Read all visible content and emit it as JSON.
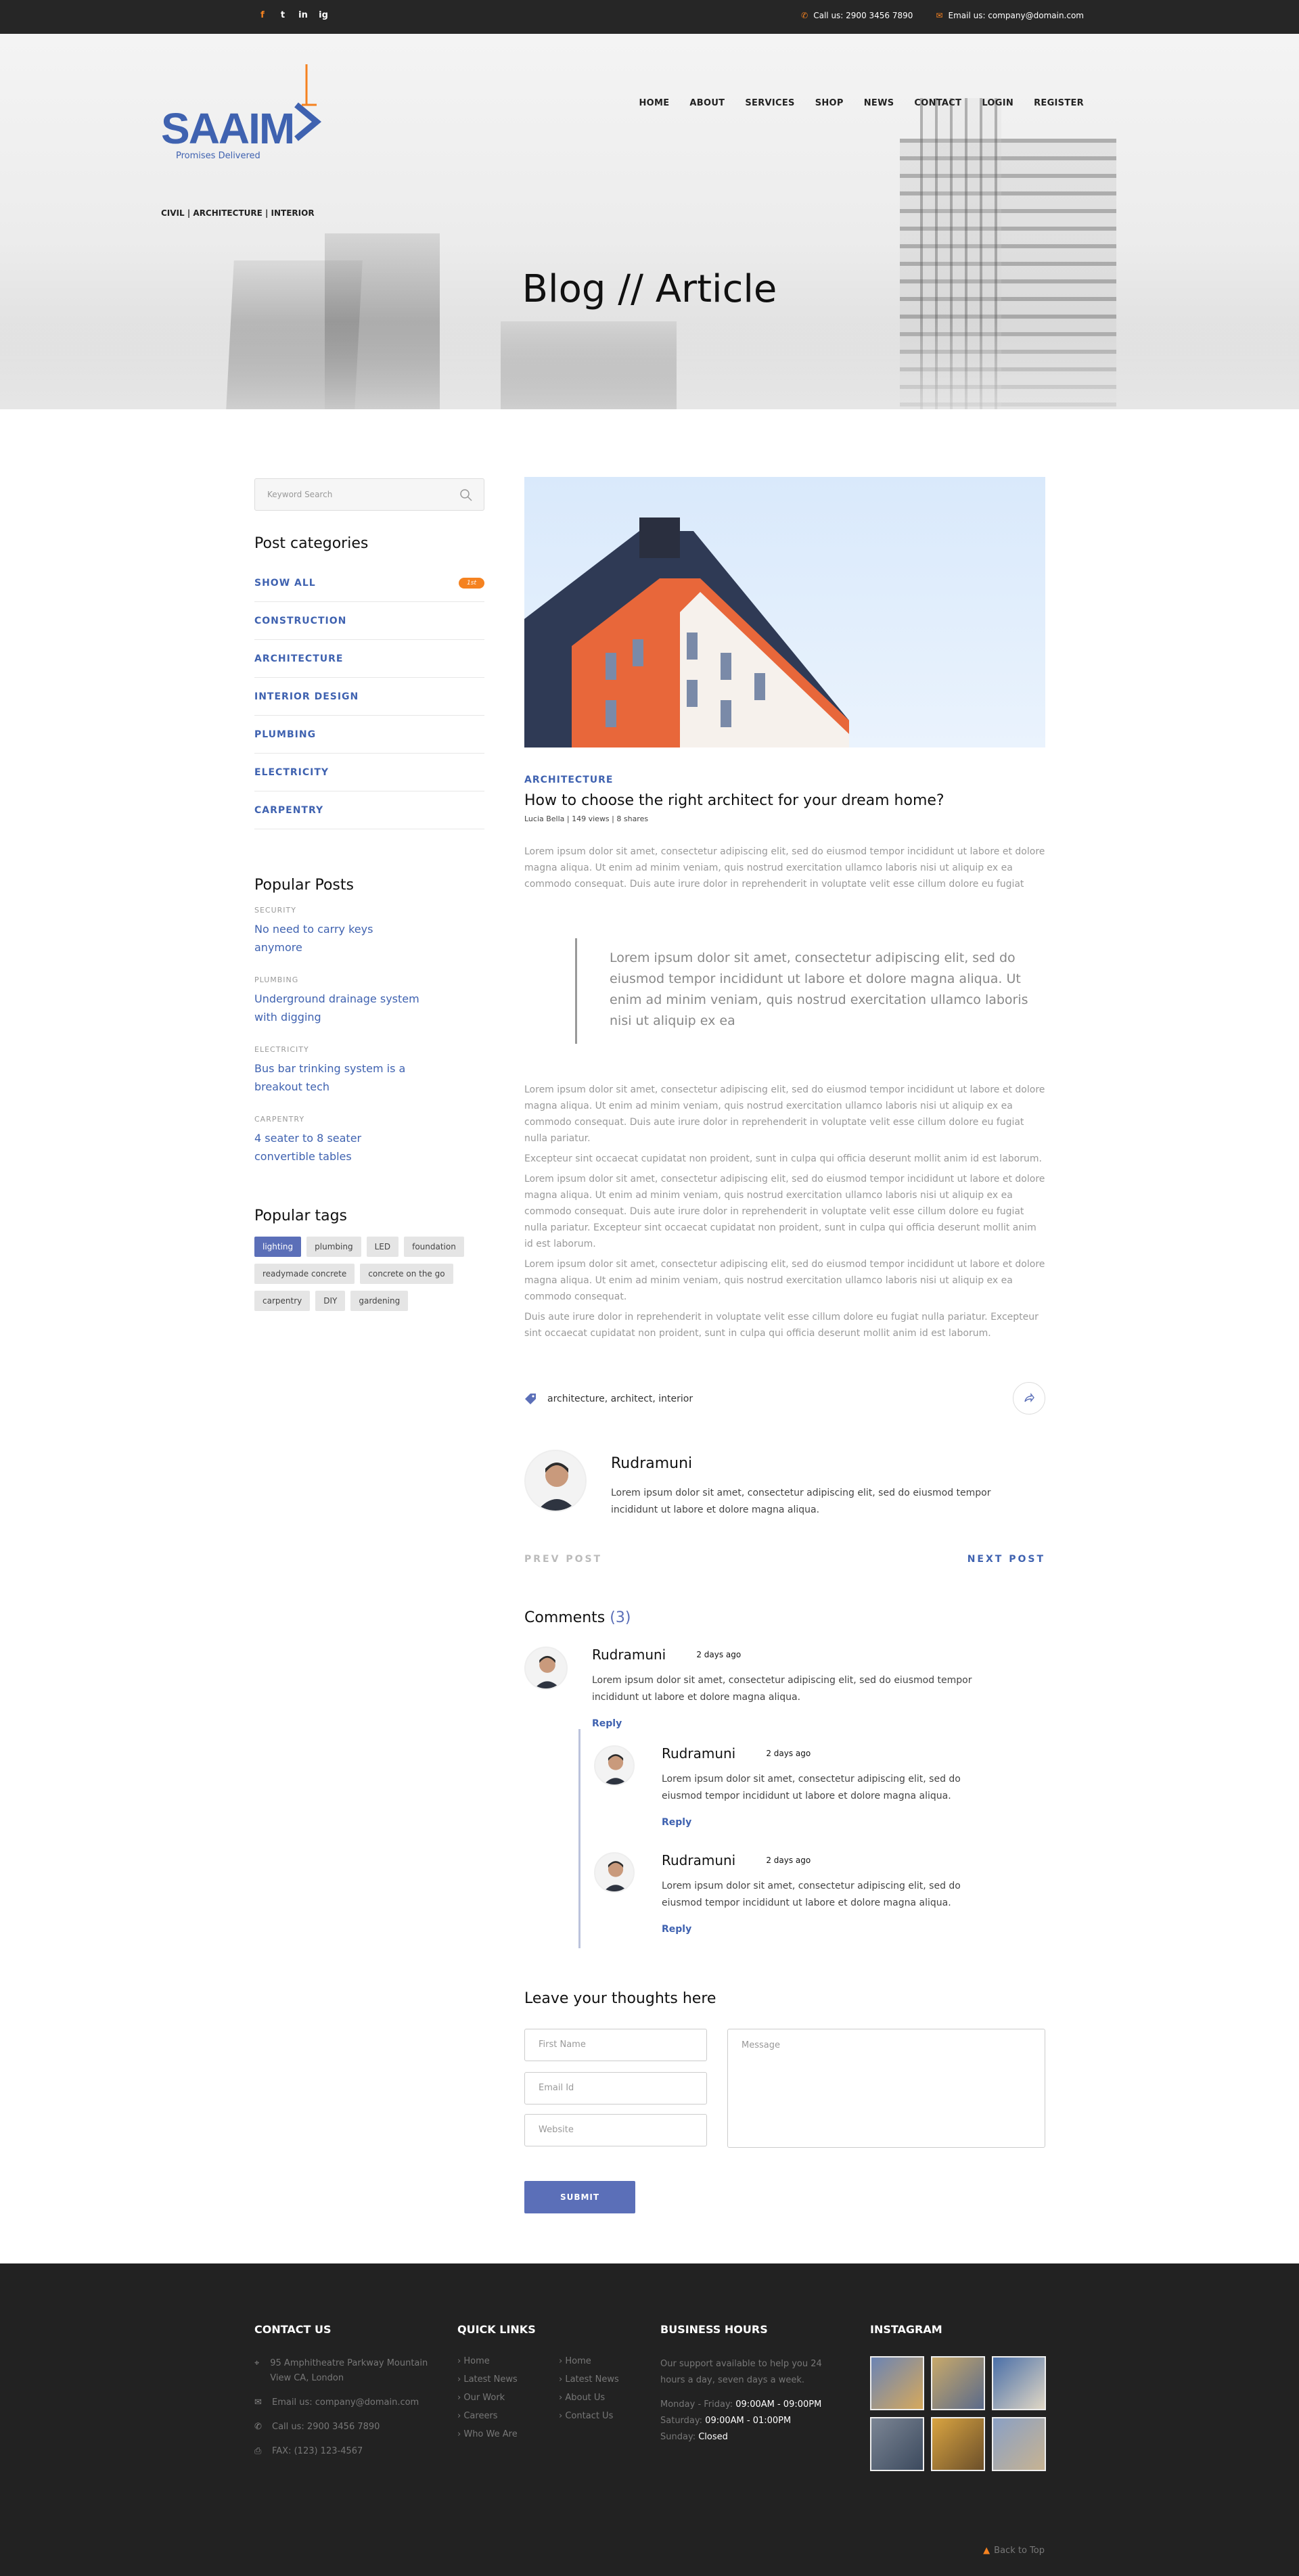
{
  "topbar": {
    "social": [
      "f",
      "t",
      "in",
      "ig"
    ],
    "phone": "Call us: 2900 3456 7890",
    "email": "Email us: company@domain.com"
  },
  "brand": {
    "name": "SAAIM",
    "tagline": "Promises Delivered",
    "sub": "CIVIL | ARCHITECTURE | INTERIOR"
  },
  "nav": [
    "HOME",
    "ABOUT",
    "SERVICES",
    "SHOP",
    "NEWS",
    "CONTACT",
    "LOGIN",
    "REGISTER"
  ],
  "hero": {
    "title": "Blog // Article"
  },
  "sidebar": {
    "search_placeholder": "Keyword Search",
    "categories_title": "Post categories",
    "categories": [
      {
        "label": "SHOW ALL",
        "badge": "1st"
      },
      {
        "label": "CONSTRUCTION"
      },
      {
        "label": "ARCHITECTURE"
      },
      {
        "label": "INTERIOR DESIGN"
      },
      {
        "label": "PLUMBING"
      },
      {
        "label": "ELECTRICITY"
      },
      {
        "label": "CARPENTRY"
      }
    ],
    "popular_title": "Popular Posts",
    "popular": [
      {
        "category": "SECURITY",
        "title": "No need to carry keys anymore"
      },
      {
        "category": "PLUMBING",
        "title": "Underground drainage system with digging"
      },
      {
        "category": "ELECTRICITY",
        "title": "Bus bar trinking system is a breakout tech"
      },
      {
        "category": "CARPENTRY",
        "title": "4 seater to 8 seater convertible tables"
      }
    ],
    "tags_title": "Popular tags",
    "tags": [
      "lighting",
      "plumbing",
      "LED",
      "foundation",
      "readymade concrete",
      "concrete on the go",
      "carpentry",
      "DIY",
      "gardening"
    ]
  },
  "post": {
    "category": "ARCHITECTURE",
    "title": "How to choose the right architect for your dream home?",
    "meta": "Lucia Bella | 149 views | 8 shares",
    "p1": "Lorem ipsum dolor sit amet, consectetur adipiscing elit, sed do eiusmod tempor incididunt ut labore et dolore magna aliqua. Ut enim ad minim veniam, quis nostrud exercitation ullamco laboris nisi ut aliquip ex ea commodo consequat. Duis aute irure dolor in reprehenderit in voluptate velit esse cillum dolore eu fugiat",
    "quote": "Lorem ipsum dolor sit amet, consectetur adipiscing elit, sed do eiusmod tempor incididunt ut labore et dolore magna aliqua. Ut enim ad minim veniam, quis nostrud exercitation ullamco laboris nisi ut aliquip ex ea",
    "p2": "Lorem ipsum dolor sit amet, consectetur adipiscing elit, sed do eiusmod tempor incididunt ut labore et dolore magna aliqua. Ut enim ad minim veniam, quis nostrud exercitation ullamco laboris nisi ut aliquip ex ea commodo consequat. Duis aute irure dolor in reprehenderit in voluptate velit esse cillum dolore eu fugiat nulla pariatur.",
    "p3": "Excepteur sint occaecat cupidatat non proident, sunt in culpa qui officia deserunt mollit anim id est laborum.",
    "p4": "Lorem ipsum dolor sit amet, consectetur adipiscing elit, sed do eiusmod tempor incididunt ut labore et dolore magna aliqua. Ut enim ad minim veniam, quis nostrud exercitation ullamco laboris nisi ut aliquip ex ea commodo consequat. Duis aute irure dolor in reprehenderit in voluptate velit esse cillum dolore eu fugiat nulla pariatur. Excepteur sint occaecat cupidatat non proident, sunt in culpa qui officia deserunt mollit anim id est laborum.",
    "p5": "Lorem ipsum dolor sit amet, consectetur adipiscing elit, sed do eiusmod tempor incididunt ut labore et dolore magna aliqua. Ut enim ad minim veniam, quis nostrud exercitation ullamco laboris nisi ut aliquip ex ea commodo consequat.",
    "p6": "Duis aute irure dolor in reprehenderit in voluptate velit esse cillum dolore eu fugiat nulla pariatur. Excepteur sint occaecat cupidatat non proident, sunt in culpa qui officia deserunt mollit anim id est laborum.",
    "tags": "architecture, architect, interior"
  },
  "author": {
    "name": "Rudramuni",
    "bio": "Lorem ipsum dolor sit amet, consectetur adipiscing elit, sed do eiusmod tempor incididunt ut labore et dolore magna aliqua."
  },
  "pager": {
    "prev": "PREV POST",
    "next": "NEXT POST"
  },
  "comments": {
    "title": "Comments",
    "count": "(3)",
    "items": [
      {
        "name": "Rudramuni",
        "date": "2 days ago",
        "text": "Lorem ipsum dolor sit amet, consectetur adipiscing elit, sed do eiusmod tempor incididunt ut labore et dolore magna aliqua.",
        "reply": "Reply"
      },
      {
        "name": "Rudramuni",
        "date": "2 days ago",
        "text": "Lorem ipsum dolor sit amet, consectetur adipiscing elit, sed do eiusmod tempor incididunt ut labore et dolore magna aliqua.",
        "reply": "Reply"
      },
      {
        "name": "Rudramuni",
        "date": "2 days ago",
        "text": "Lorem ipsum dolor sit amet, consectetur adipiscing elit, sed do eiusmod tempor incididunt ut labore et dolore magna aliqua.",
        "reply": "Reply"
      }
    ]
  },
  "form": {
    "title": "Leave your thoughts here",
    "first_name": "First Name",
    "email": "Email Id",
    "website": "Website",
    "message": "Message",
    "submit": "SUBMIT"
  },
  "footer": {
    "contact_title": "CONTACT US",
    "address": "95 Amphitheatre Parkway Mountain View CA, London",
    "email": "Email us: company@domain.com",
    "phone": "Call us: 2900 3456 7890",
    "fax": "FAX: (123) 123-4567",
    "links_title": "QUICK LINKS",
    "links": [
      "Home",
      "Home",
      "Latest News",
      "Latest News",
      "Our Work",
      "About Us",
      "Careers",
      "Contact Us",
      "Who We Are"
    ],
    "hours_title": "BUSINESS HOURS",
    "hours_text": "Our support available to help you 24 hours a day, seven days a week.",
    "hours": [
      {
        "day": "Monday - Friday:",
        "time": "09:00AM - 09:00PM"
      },
      {
        "day": "Saturday:",
        "time": "09:00AM - 01:00PM"
      },
      {
        "day": "Sunday:",
        "time": "Closed"
      }
    ],
    "insta_title": "INSTAGRAM",
    "back_to_top": "Back to Top"
  },
  "colors": {
    "accent": "#3f62b0",
    "orange": "#f58220",
    "button": "#5b6fb8",
    "dark": "#262626"
  }
}
